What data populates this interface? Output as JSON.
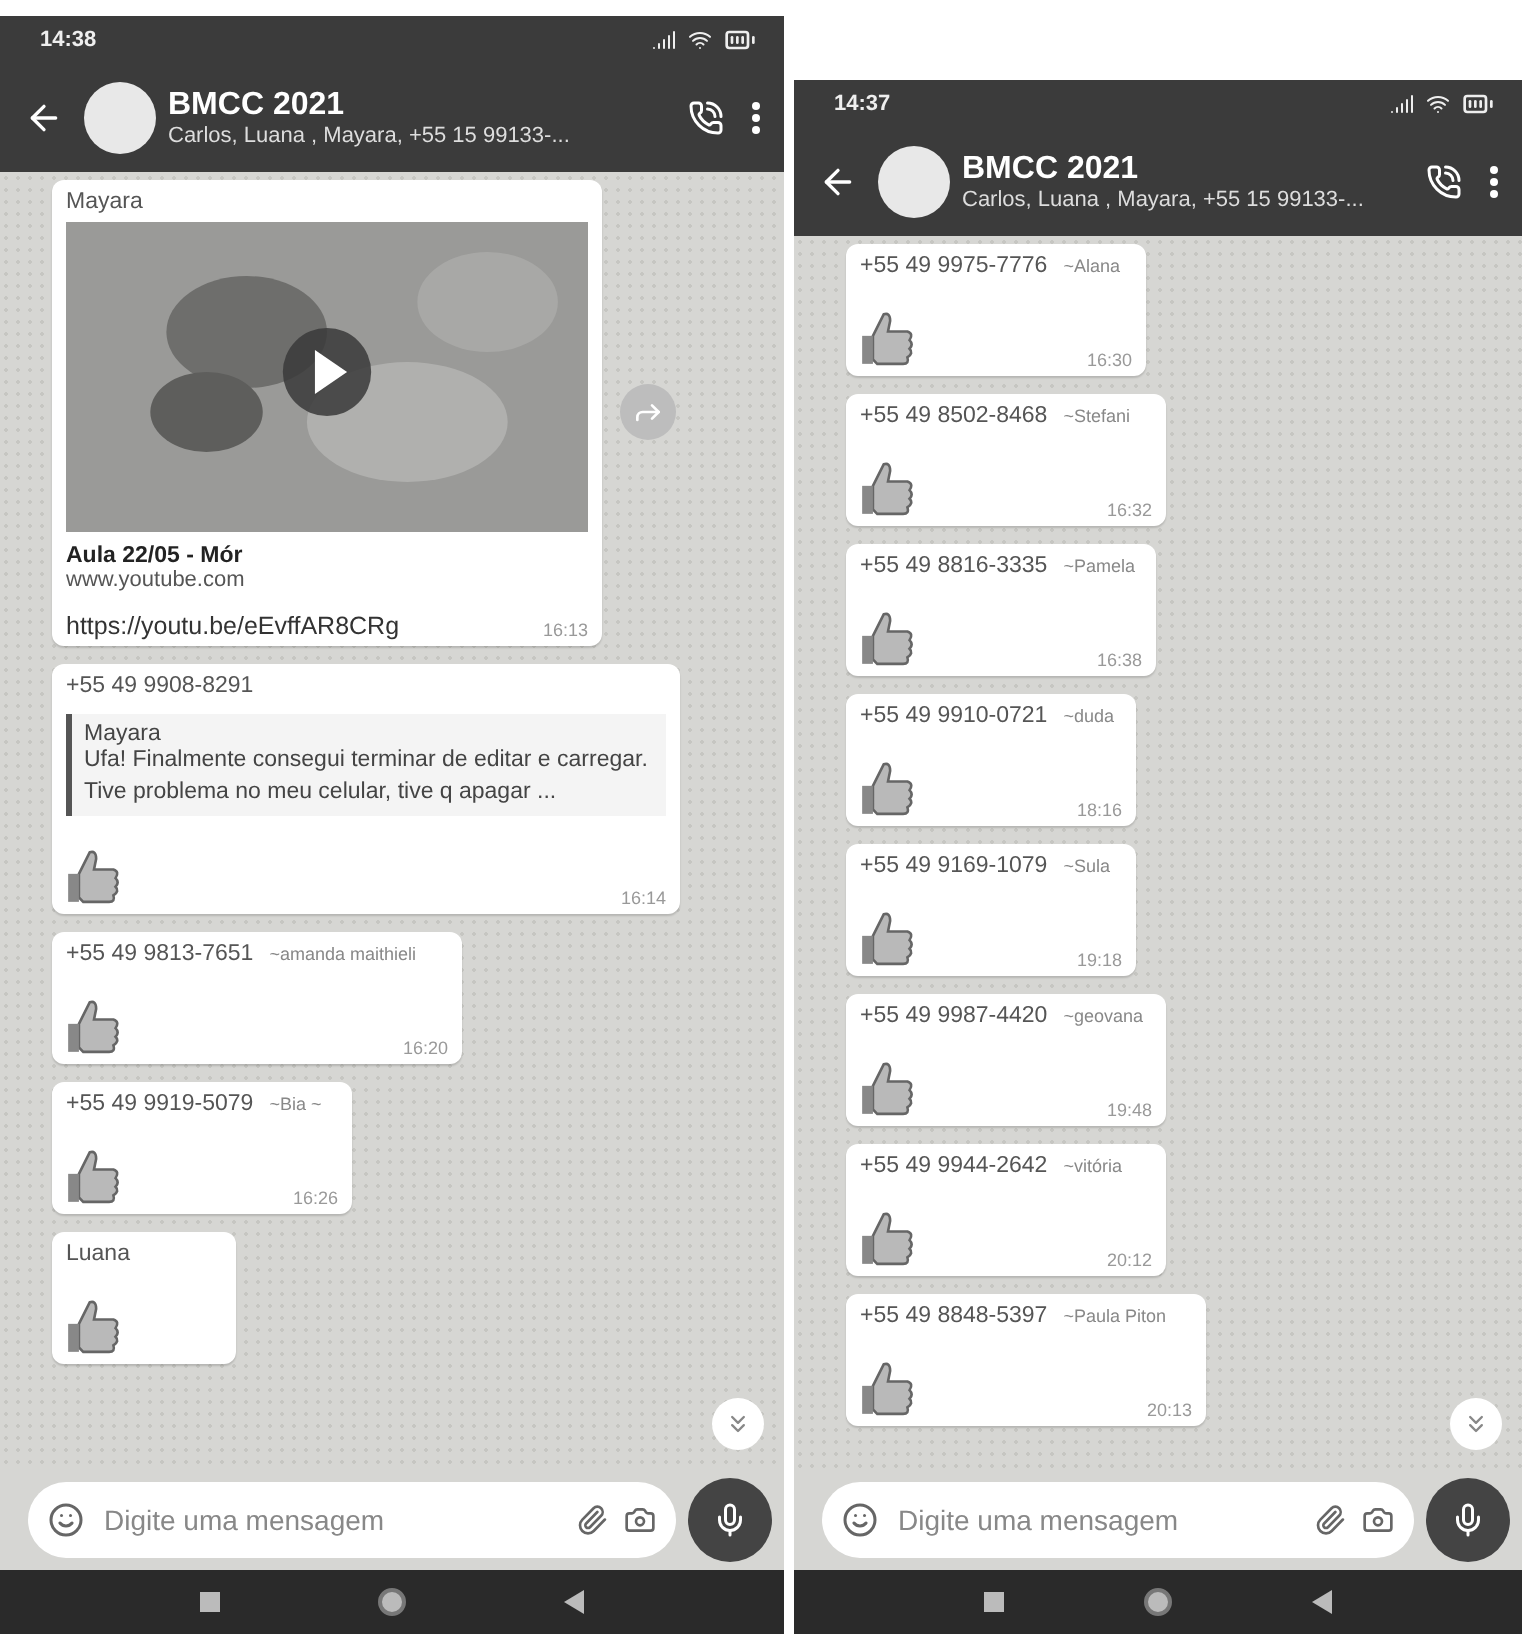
{
  "screens": [
    {
      "status_bar": {
        "time": "14:38"
      },
      "header": {
        "title": "BMCC 2021",
        "subtitle": "Carlos, Luana , Mayara, +55 15 99133-..."
      },
      "messages": [
        {
          "kind": "video",
          "sender": "Mayara",
          "title": "Aula 22/05 - Mór",
          "domain": "www.youtube.com",
          "link": "https://youtu.be/eEvffAR8CRg",
          "time": "16:13"
        },
        {
          "kind": "reply",
          "sender": "+55 49 9908-8291",
          "quote": {
            "author": "Mayara",
            "lines": [
              "Ufa! Finalmente consegui terminar de editar e carregar.",
              "Tive problema no meu celular, tive q apagar ..."
            ]
          },
          "time": "16:14"
        },
        {
          "kind": "sticker",
          "sender": "+55 49 9813-7651",
          "alias": "~amanda maithieli",
          "time": "16:20"
        },
        {
          "kind": "sticker",
          "sender": "+55 49 9919-5079",
          "alias": "~Bia ~",
          "time": "16:26"
        },
        {
          "kind": "sticker",
          "sender": "Luana"
        }
      ],
      "composer": {
        "placeholder": "Digite uma mensagem"
      }
    },
    {
      "status_bar": {
        "time": "14:37"
      },
      "header": {
        "title": "BMCC 2021",
        "subtitle": "Carlos, Luana , Mayara, +55 15 99133-..."
      },
      "messages": [
        {
          "kind": "sticker",
          "sender": "+55 49 9975-7776",
          "alias": "~Alana",
          "time": "16:30"
        },
        {
          "kind": "sticker",
          "sender": "+55 49 8502-8468",
          "alias": "~Stefani",
          "time": "16:32"
        },
        {
          "kind": "sticker",
          "sender": "+55 49 8816-3335",
          "alias": "~Pamela",
          "time": "16:38"
        },
        {
          "kind": "sticker",
          "sender": "+55 49 9910-0721",
          "alias": "~duda",
          "time": "18:16"
        },
        {
          "kind": "sticker",
          "sender": "+55 49 9169-1079",
          "alias": "~Sula",
          "time": "19:18"
        },
        {
          "kind": "sticker",
          "sender": "+55 49 9987-4420",
          "alias": "~geovana",
          "time": "19:48"
        },
        {
          "kind": "sticker",
          "sender": "+55 49 9944-2642",
          "alias": "~vitória",
          "time": "20:12"
        },
        {
          "kind": "sticker",
          "sender": "+55 49 8848-5397",
          "alias": "~Paula Piton",
          "time": "20:13"
        }
      ],
      "composer": {
        "placeholder": "Digite uma mensagem"
      }
    }
  ]
}
